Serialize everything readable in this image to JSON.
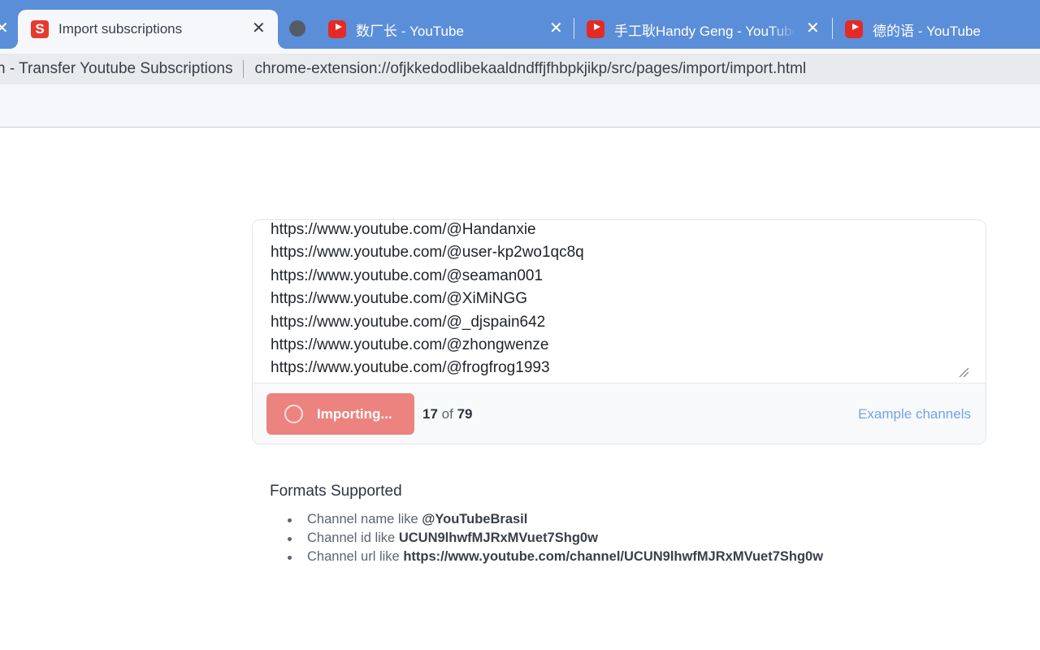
{
  "browser": {
    "tabs": [
      {
        "title": "Import subscriptions",
        "icon": "subscription-transfer-logo",
        "active": true
      },
      {
        "title": "",
        "icon": "loading-dot-icon"
      },
      {
        "title": "数厂长 - YouTube",
        "icon": "youtube-icon"
      },
      {
        "title": "手工耿Handy Geng - YouTube",
        "icon": "youtube-icon"
      },
      {
        "title": "德的语 - YouTube",
        "icon": "youtube-icon"
      }
    ],
    "extension_name": "h - Transfer Youtube Subscriptions",
    "url": "chrome-extension://ofjkkedodlibekaaldndffjfhbpkjikp/src/pages/import/import.html"
  },
  "importer": {
    "channel_urls": [
      "https://www.youtube.com/@Handanxie",
      "https://www.youtube.com/@user-kp2wo1qc8q",
      "https://www.youtube.com/@seaman001",
      "https://www.youtube.com/@XiMiNGG",
      "https://www.youtube.com/@_djspain642",
      "https://www.youtube.com/@zhongwenze",
      "https://www.youtube.com/@frogfrog1993"
    ],
    "import_button_label": "Importing...",
    "progress": {
      "current": "17",
      "separator": "of",
      "total": "79"
    },
    "example_link": "Example channels"
  },
  "formats": {
    "heading": "Formats Supported",
    "items": [
      {
        "prefix": "Channel name like",
        "value": "@YouTubeBrasil"
      },
      {
        "prefix": "Channel id like",
        "value": "UCUN9lhwfMJRxMVuet7Shg0w"
      },
      {
        "prefix": "Channel url like",
        "value": "https://www.youtube.com/channel/UCUN9lhwfMJRxMVuet7Shg0w"
      }
    ]
  },
  "colors": {
    "tab_strip": "#5b8ed8",
    "import_button": "#ec837e",
    "link": "#74a3e8"
  }
}
